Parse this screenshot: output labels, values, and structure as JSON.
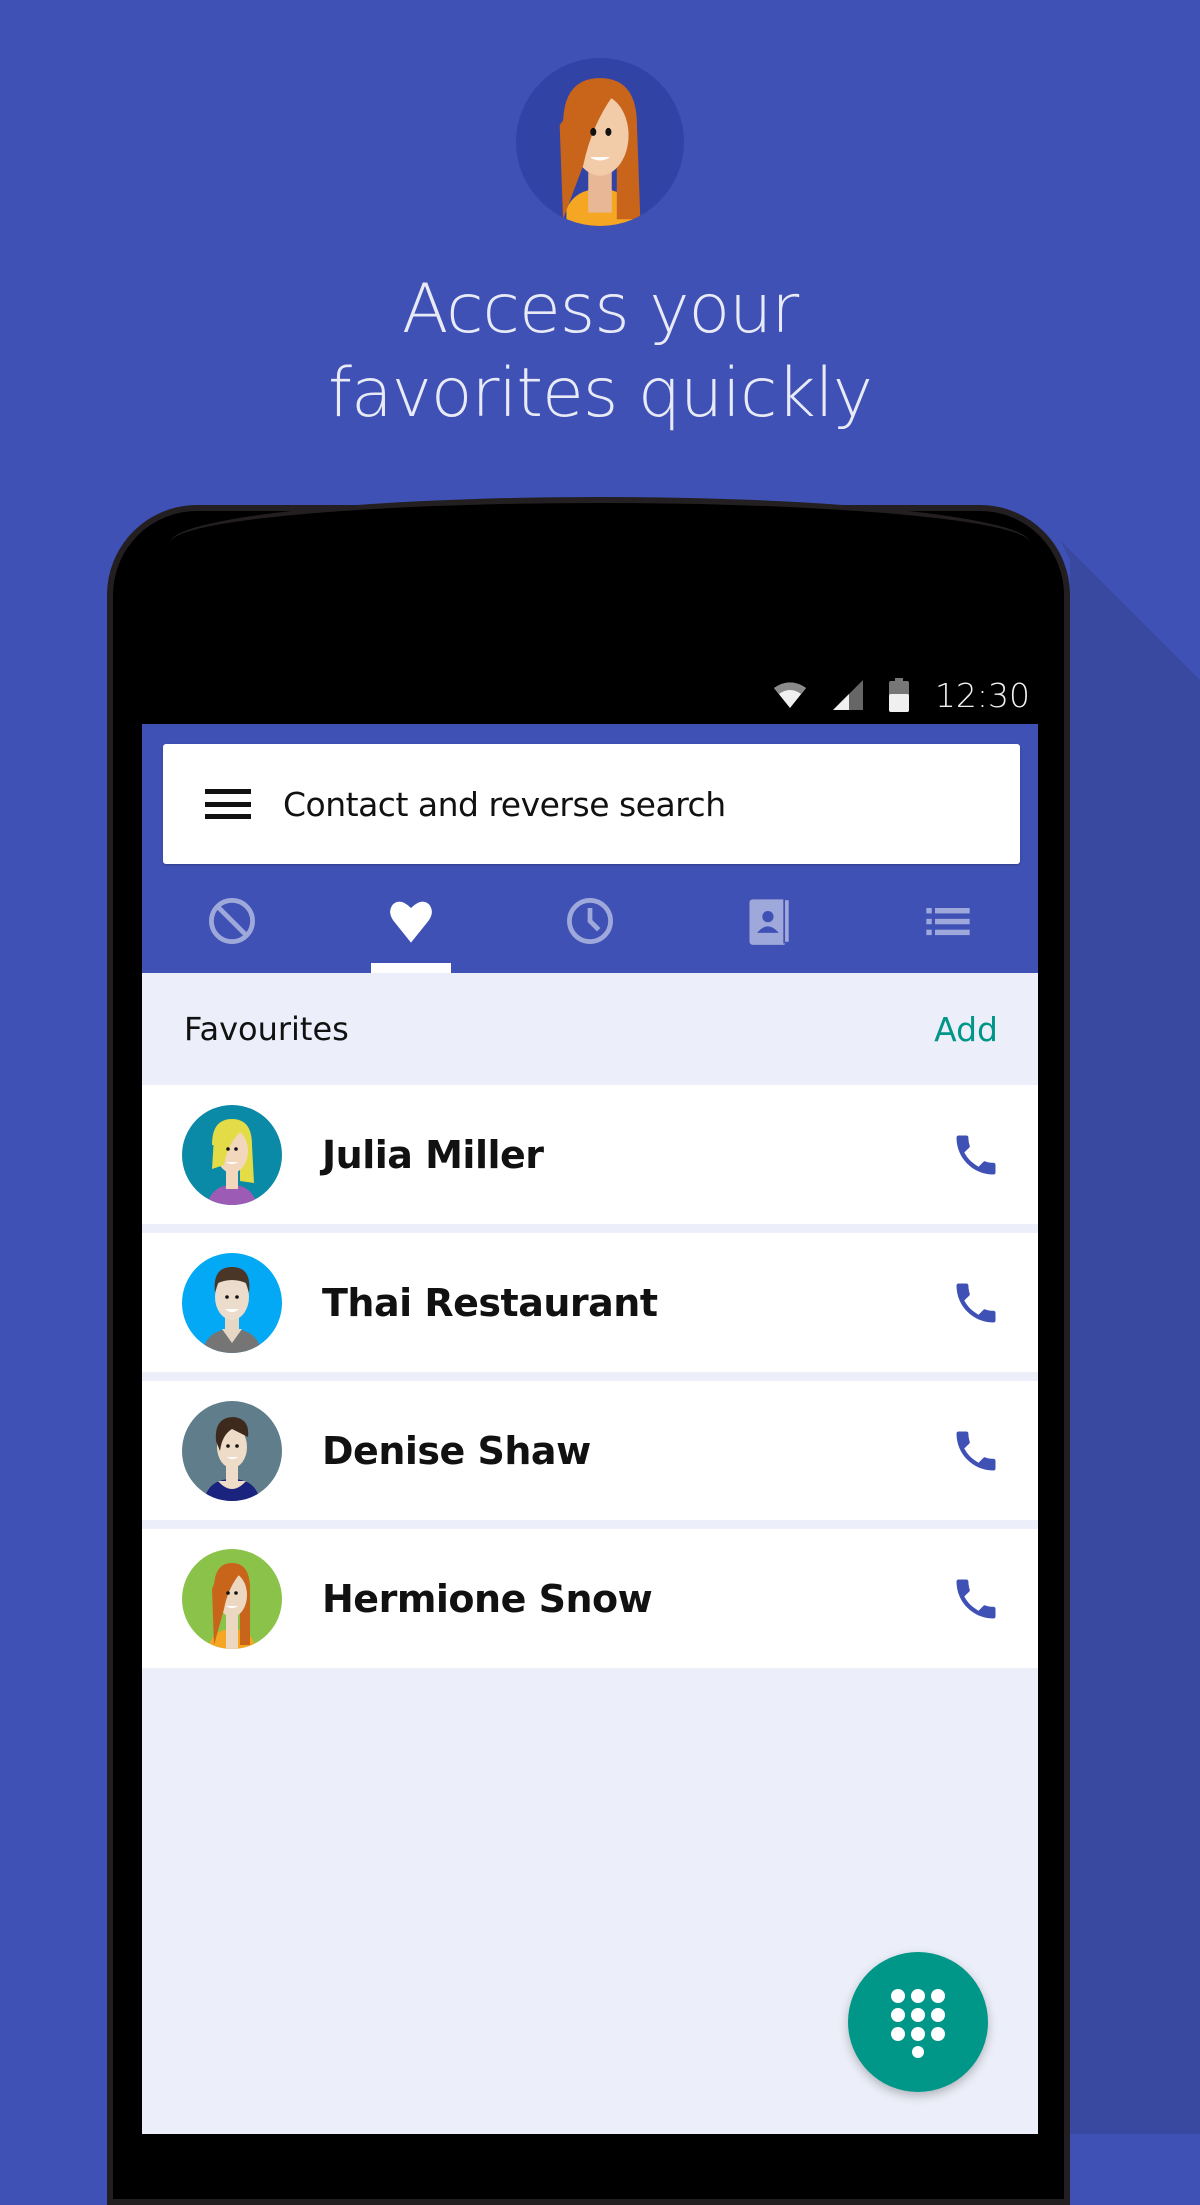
{
  "hero": {
    "title_line1": "Access your",
    "title_line2": "favorites quickly",
    "avatar": "woman-avatar-red-hair"
  },
  "statusbar": {
    "icons": [
      "wifi-icon",
      "cellular-signal-icon",
      "battery-icon"
    ],
    "time": "12:30"
  },
  "search": {
    "menu_icon": "hamburger-menu-icon",
    "placeholder": "Contact and reverse search"
  },
  "tabs": [
    {
      "id": "blocked",
      "icon": "block-icon",
      "active": false
    },
    {
      "id": "favourites",
      "icon": "heart-icon",
      "active": true
    },
    {
      "id": "recents",
      "icon": "clock-icon",
      "active": false
    },
    {
      "id": "contacts",
      "icon": "contacts-book-icon",
      "active": false
    },
    {
      "id": "lists",
      "icon": "list-icon",
      "active": false
    }
  ],
  "favourites": {
    "title": "Favourites",
    "add_label": "Add",
    "contacts": [
      {
        "name": "Julia Miller",
        "avatar_bg": "#0a8aa6"
      },
      {
        "name": "Thai Restaurant",
        "avatar_bg": "#03a9f4"
      },
      {
        "name": "Denise Shaw",
        "avatar_bg": "#607d8b"
      },
      {
        "name": "Hermione Snow",
        "avatar_bg": "#8bc34a"
      }
    ]
  },
  "fab": {
    "icon": "dialpad-icon"
  },
  "colors": {
    "primary": "#3f51b5",
    "accent": "#009688",
    "call_icon": "#3f51b5",
    "list_bg": "#eceff9"
  }
}
